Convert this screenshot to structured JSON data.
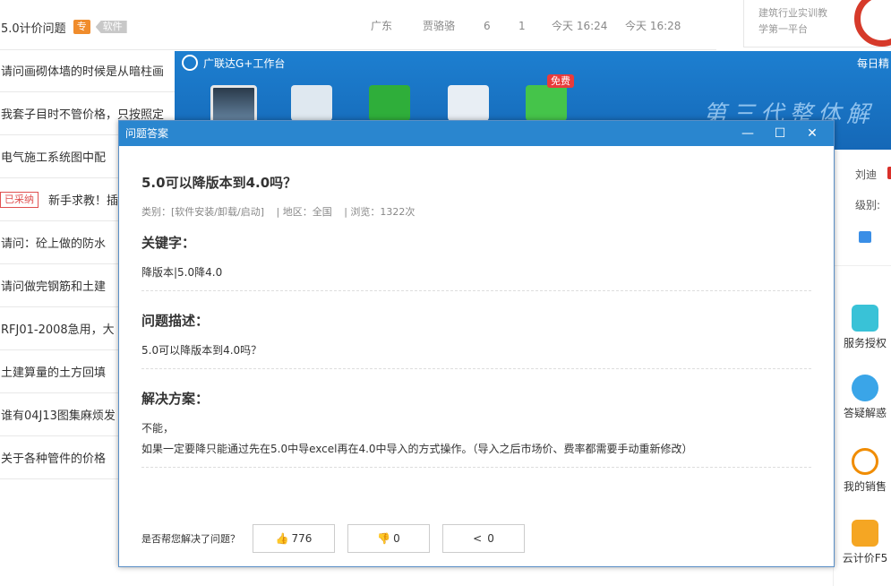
{
  "list": {
    "first": {
      "title": "5.0计价问题",
      "tag_special": "专",
      "tag_category": "软件",
      "region": "广东",
      "user": "贾骆骆",
      "replies": "6",
      "views": "1",
      "time1": "今天  16:24",
      "time2": "今天  16:28"
    },
    "rows": [
      "请问画砌体墙的时候是从暗柱画",
      "我套子目时不管价格，只按照定",
      "电气施工系统图中配",
      "新手求教！插",
      "请问：砼上做的防水",
      "请问做完钢筋和土建",
      "RFJ01-2008急用，大",
      "土建算量的土方回填",
      "谁有04J13图集麻烦发",
      "关于各种管件的价格"
    ],
    "adopted_label": "已采纳"
  },
  "ad": {
    "line1": "建筑行业实训教",
    "line2": "学第一平台"
  },
  "side": {
    "user": "刘迪",
    "level": "级别:",
    "services": [
      "服务授权",
      "答疑解惑",
      "我的销售",
      "云计价F5"
    ]
  },
  "workbench": {
    "title": "广联达G+工作台",
    "right_text": "每日精",
    "free_badge": "免费",
    "banner": "第三代整体解决"
  },
  "dialog": {
    "window_title": "问题答案",
    "controls": {
      "minimize": "—",
      "maximize": "☐",
      "close": "✕"
    },
    "question_title": "5.0可以降版本到4.0吗？",
    "meta": {
      "category": "类别：[软件安装/卸载/启动]",
      "region": "| 地区：全国",
      "views": "| 浏览：1322次"
    },
    "keywords_label": "关键字：",
    "keywords": "降版本|5.0降4.0",
    "desc_label": "问题描述：",
    "desc": "5.0可以降版本到4.0吗？",
    "solution_label": "解决方案：",
    "solution_line1": "不能，",
    "solution_line2": "如果一定要降只能通过先在5.0中导excel再在4.0中导入的方式操作。（导入之后市场价、费率都需要手动重新修改）",
    "footer_q": "是否帮您解决了问题？",
    "like": "776",
    "dislike": "0",
    "share": "0"
  }
}
